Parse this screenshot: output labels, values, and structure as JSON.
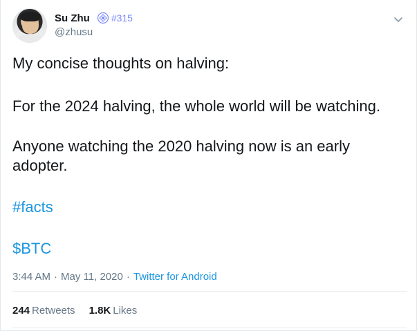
{
  "user": {
    "display_name": "Su Zhu",
    "badge_text": "#315",
    "handle": "@zhusu"
  },
  "tweet": {
    "paragraphs": [
      "My concise thoughts on halving:",
      "For the 2024 halving, the whole world will be watching.",
      "Anyone watching the 2020 halving now is an early adopter.",
      "#facts",
      "$BTC"
    ]
  },
  "meta": {
    "time": "3:44 AM",
    "separator": "·",
    "date": "May 11, 2020",
    "source": "Twitter for Android"
  },
  "stats": {
    "retweets_count": "244",
    "retweets_label": "Retweets",
    "likes_count": "1.8K",
    "likes_label": "Likes"
  },
  "colors": {
    "link": "#1b95e0",
    "badge": "#7b8bf5",
    "secondary_text": "#657786"
  },
  "icons": {
    "badge": "glyph-badge-icon",
    "more": "chevron-down-icon"
  }
}
